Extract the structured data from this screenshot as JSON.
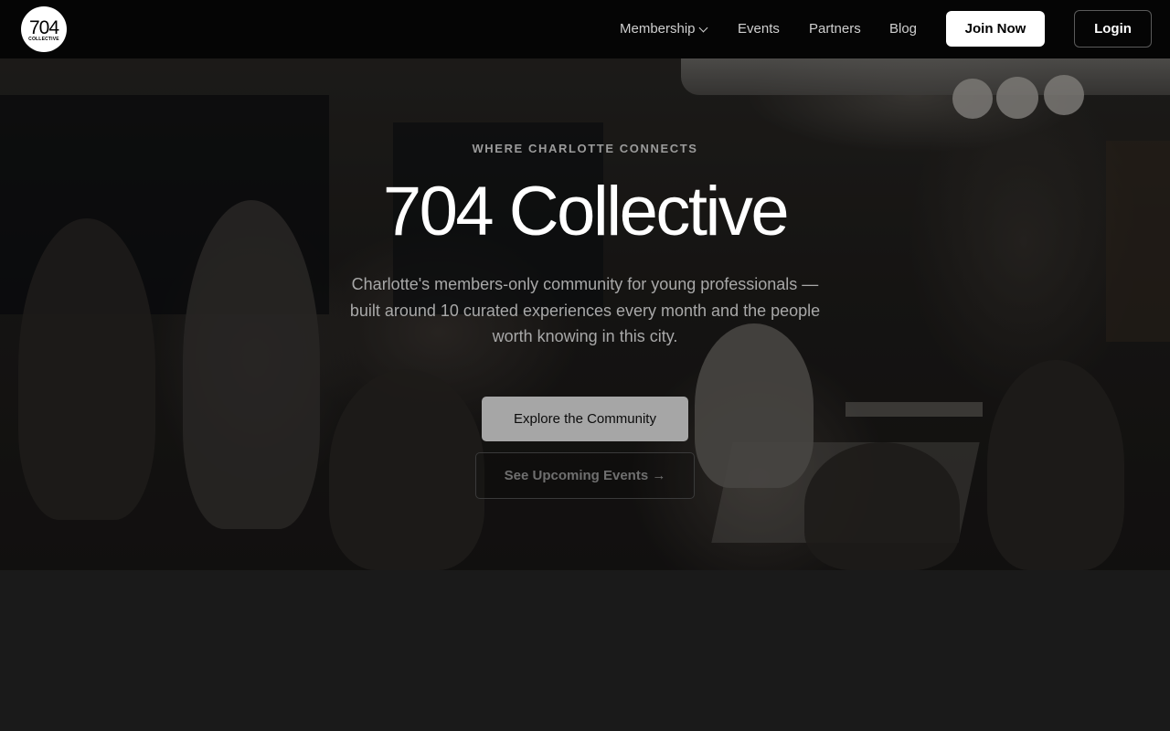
{
  "brand": {
    "logo_number": "704",
    "logo_subtext": "COLLECTIVE"
  },
  "nav": {
    "items": [
      {
        "label": "Membership",
        "has_dropdown": true
      },
      {
        "label": "Events"
      },
      {
        "label": "Partners"
      },
      {
        "label": "Blog"
      }
    ],
    "join_label": "Join Now",
    "login_label": "Login"
  },
  "hero": {
    "eyebrow": "WHERE CHARLOTTE CONNECTS",
    "title": "704 Collective",
    "subtitle": "Charlotte's members-only community for young professionals — built around 10 curated experiences every month and the people worth knowing in this city.",
    "primary_cta": "Explore the Community",
    "secondary_cta": "See Upcoming Events →",
    "background_image": "dimly lit bar with people socializing"
  },
  "colors": {
    "nav_bg": "#050505",
    "page_bg": "#1a1a1a",
    "primary_button": "#a6a6a6",
    "join_button": "#ffffff"
  }
}
